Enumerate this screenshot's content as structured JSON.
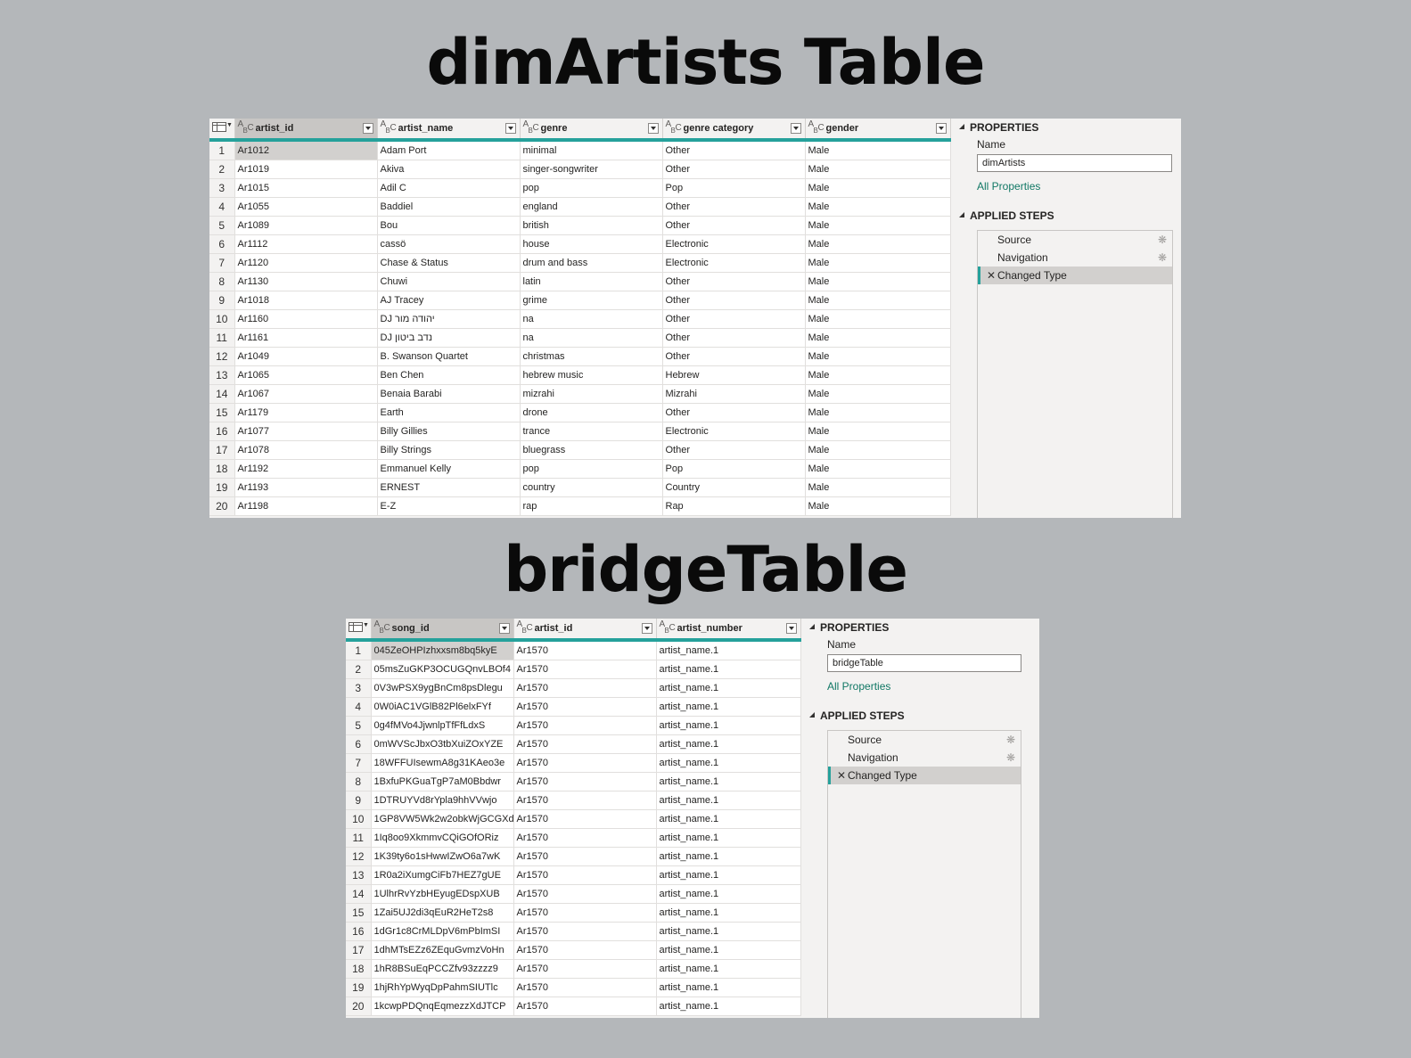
{
  "top": {
    "title": "dimArtists Table",
    "columns": [
      "artist_id",
      "artist_name",
      "genre",
      "genre category",
      "gender"
    ],
    "rows": [
      [
        "1",
        "Ar1012",
        "Adam Port",
        "minimal",
        "Other",
        "Male"
      ],
      [
        "2",
        "Ar1019",
        "Akiva",
        "singer-songwriter",
        "Other",
        "Male"
      ],
      [
        "3",
        "Ar1015",
        "Adil C",
        "pop",
        "Pop",
        "Male"
      ],
      [
        "4",
        "Ar1055",
        "Baddiel",
        "england",
        "Other",
        "Male"
      ],
      [
        "5",
        "Ar1089",
        "Bou",
        "british",
        "Other",
        "Male"
      ],
      [
        "6",
        "Ar1112",
        "cassö",
        "house",
        "Electronic",
        "Male"
      ],
      [
        "7",
        "Ar1120",
        "Chase & Status",
        "drum and bass",
        "Electronic",
        "Male"
      ],
      [
        "8",
        "Ar1130",
        "Chuwi",
        "latin",
        "Other",
        "Male"
      ],
      [
        "9",
        "Ar1018",
        "AJ Tracey",
        "grime",
        "Other",
        "Male"
      ],
      [
        "10",
        "Ar1160",
        "DJ יהודה מור",
        "na",
        "Other",
        "Male"
      ],
      [
        "11",
        "Ar1161",
        "DJ נדב ביטון",
        "na",
        "Other",
        "Male"
      ],
      [
        "12",
        "Ar1049",
        "B. Swanson Quartet",
        "christmas",
        "Other",
        "Male"
      ],
      [
        "13",
        "Ar1065",
        "Ben Chen",
        "hebrew music",
        "Hebrew",
        "Male"
      ],
      [
        "14",
        "Ar1067",
        "Benaia Barabi",
        "mizrahi",
        "Mizrahi",
        "Male"
      ],
      [
        "15",
        "Ar1179",
        "Earth",
        "drone",
        "Other",
        "Male"
      ],
      [
        "16",
        "Ar1077",
        "Billy Gillies",
        "trance",
        "Electronic",
        "Male"
      ],
      [
        "17",
        "Ar1078",
        "Billy Strings",
        "bluegrass",
        "Other",
        "Male"
      ],
      [
        "18",
        "Ar1192",
        "Emmanuel Kelly",
        "pop",
        "Pop",
        "Male"
      ],
      [
        "19",
        "Ar1193",
        "ERNEST",
        "country",
        "Country",
        "Male"
      ],
      [
        "20",
        "Ar1198",
        "E-Z",
        "rap",
        "Rap",
        "Male"
      ]
    ],
    "properties_label": "PROPERTIES",
    "name_label": "Name",
    "name_value": "dimArtists",
    "all_properties": "All Properties",
    "applied_steps_label": "APPLIED STEPS",
    "steps": [
      "Source",
      "Navigation",
      "Changed Type"
    ]
  },
  "bottom": {
    "title": "bridgeTable",
    "columns": [
      "song_id",
      "artist_id",
      "artist_number"
    ],
    "rows": [
      [
        "1",
        "045ZeOHPIzhxxsm8bq5kyE",
        "Ar1570",
        "artist_name.1"
      ],
      [
        "2",
        "05msZuGKP3OCUGQnvLBOf4",
        "Ar1570",
        "artist_name.1"
      ],
      [
        "3",
        "0V3wPSX9ygBnCm8psDlegu",
        "Ar1570",
        "artist_name.1"
      ],
      [
        "4",
        "0W0iAC1VGlB82Pl6elxFYf",
        "Ar1570",
        "artist_name.1"
      ],
      [
        "5",
        "0g4fMVo4JjwnlpTfFfLdxS",
        "Ar1570",
        "artist_name.1"
      ],
      [
        "6",
        "0mWVScJbxO3tbXuiZOxYZE",
        "Ar1570",
        "artist_name.1"
      ],
      [
        "7",
        "18WFFUIsewmA8g31KAeo3e",
        "Ar1570",
        "artist_name.1"
      ],
      [
        "8",
        "1BxfuPKGuaTgP7aM0Bbdwr",
        "Ar1570",
        "artist_name.1"
      ],
      [
        "9",
        "1DTRUYVd8rYpla9hhVVwjo",
        "Ar1570",
        "artist_name.1"
      ],
      [
        "10",
        "1GP8VW5Wk2w2obkWjGCGXd",
        "Ar1570",
        "artist_name.1"
      ],
      [
        "11",
        "1Iq8oo9XkmmvCQiGOfORiz",
        "Ar1570",
        "artist_name.1"
      ],
      [
        "12",
        "1K39ty6o1sHwwIZwO6a7wK",
        "Ar1570",
        "artist_name.1"
      ],
      [
        "13",
        "1R0a2iXumgCiFb7HEZ7gUE",
        "Ar1570",
        "artist_name.1"
      ],
      [
        "14",
        "1UlhrRvYzbHEyugEDspXUB",
        "Ar1570",
        "artist_name.1"
      ],
      [
        "15",
        "1Zai5UJ2di3qEuR2HeT2s8",
        "Ar1570",
        "artist_name.1"
      ],
      [
        "16",
        "1dGr1c8CrMLDpV6mPbImSI",
        "Ar1570",
        "artist_name.1"
      ],
      [
        "17",
        "1dhMTsEZz6ZEquGvmzVoHn",
        "Ar1570",
        "artist_name.1"
      ],
      [
        "18",
        "1hR8BSuEqPCCZfv93zzzz9",
        "Ar1570",
        "artist_name.1"
      ],
      [
        "19",
        "1hjRhYpWyqDpPahmSIUTlc",
        "Ar1570",
        "artist_name.1"
      ],
      [
        "20",
        "1kcwpPDQnqEqmezzXdJTCP",
        "Ar1570",
        "artist_name.1"
      ]
    ],
    "properties_label": "PROPERTIES",
    "name_label": "Name",
    "name_value": "bridgeTable",
    "all_properties": "All Properties",
    "applied_steps_label": "APPLIED STEPS",
    "steps": [
      "Source",
      "Navigation",
      "Changed Type"
    ]
  },
  "colors": {
    "background": "#b4b7ba",
    "accent": "#25a19b",
    "link": "#117865"
  },
  "icons": {
    "column_type": "abc-text-type-icon",
    "table_menu": "table-icon",
    "filter": "dropdown-filter-icon",
    "step_settings": "gear-icon",
    "step_delete": "delete-x-icon"
  }
}
